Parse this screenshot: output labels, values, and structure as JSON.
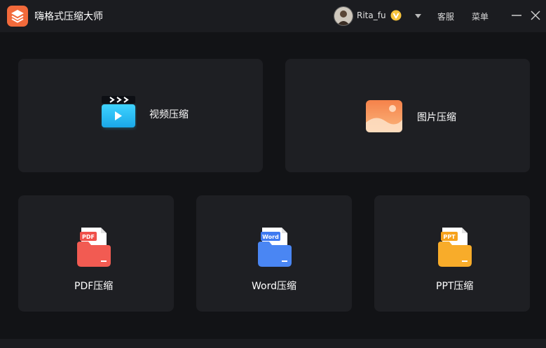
{
  "app": {
    "title": "嗨格式压缩大师",
    "logo_icon": "stacked-layers-icon"
  },
  "header": {
    "username": "Rita_fu",
    "vip_icon": "vip-badge-icon",
    "support_label": "客服",
    "menu_label": "菜单"
  },
  "cards": {
    "video": {
      "label": "视频压缩",
      "icon": "video-clapper-icon"
    },
    "image": {
      "label": "图片压缩",
      "icon": "image-landscape-icon"
    },
    "pdf": {
      "label": "PDF压缩",
      "icon": "pdf-folder-icon",
      "tag": "PDF"
    },
    "word": {
      "label": "Word压缩",
      "icon": "word-folder-icon",
      "tag": "Word"
    },
    "ppt": {
      "label": "PPT压缩",
      "icon": "ppt-folder-icon",
      "tag": "PPT"
    }
  },
  "colors": {
    "accent_orange": "#f26a3b",
    "video_blue": "#24c3f4",
    "pdf_red": "#f0504a",
    "word_blue": "#3f7af0",
    "ppt_orange": "#f6a21c"
  }
}
